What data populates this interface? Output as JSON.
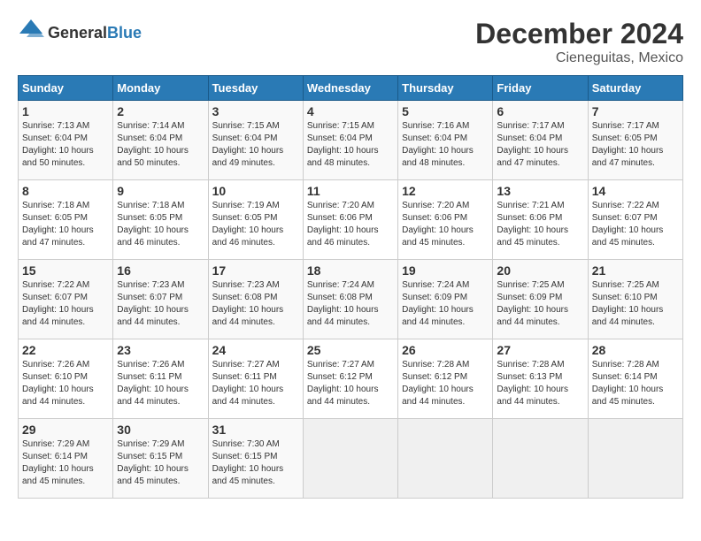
{
  "header": {
    "logo_general": "General",
    "logo_blue": "Blue",
    "month_title": "December 2024",
    "subtitle": "Cieneguitas, Mexico"
  },
  "weekdays": [
    "Sunday",
    "Monday",
    "Tuesday",
    "Wednesday",
    "Thursday",
    "Friday",
    "Saturday"
  ],
  "weeks": [
    [
      {
        "day": "1",
        "info": "Sunrise: 7:13 AM\nSunset: 6:04 PM\nDaylight: 10 hours\nand 50 minutes."
      },
      {
        "day": "2",
        "info": "Sunrise: 7:14 AM\nSunset: 6:04 PM\nDaylight: 10 hours\nand 50 minutes."
      },
      {
        "day": "3",
        "info": "Sunrise: 7:15 AM\nSunset: 6:04 PM\nDaylight: 10 hours\nand 49 minutes."
      },
      {
        "day": "4",
        "info": "Sunrise: 7:15 AM\nSunset: 6:04 PM\nDaylight: 10 hours\nand 48 minutes."
      },
      {
        "day": "5",
        "info": "Sunrise: 7:16 AM\nSunset: 6:04 PM\nDaylight: 10 hours\nand 48 minutes."
      },
      {
        "day": "6",
        "info": "Sunrise: 7:17 AM\nSunset: 6:04 PM\nDaylight: 10 hours\nand 47 minutes."
      },
      {
        "day": "7",
        "info": "Sunrise: 7:17 AM\nSunset: 6:05 PM\nDaylight: 10 hours\nand 47 minutes."
      }
    ],
    [
      {
        "day": "8",
        "info": "Sunrise: 7:18 AM\nSunset: 6:05 PM\nDaylight: 10 hours\nand 47 minutes."
      },
      {
        "day": "9",
        "info": "Sunrise: 7:18 AM\nSunset: 6:05 PM\nDaylight: 10 hours\nand 46 minutes."
      },
      {
        "day": "10",
        "info": "Sunrise: 7:19 AM\nSunset: 6:05 PM\nDaylight: 10 hours\nand 46 minutes."
      },
      {
        "day": "11",
        "info": "Sunrise: 7:20 AM\nSunset: 6:06 PM\nDaylight: 10 hours\nand 46 minutes."
      },
      {
        "day": "12",
        "info": "Sunrise: 7:20 AM\nSunset: 6:06 PM\nDaylight: 10 hours\nand 45 minutes."
      },
      {
        "day": "13",
        "info": "Sunrise: 7:21 AM\nSunset: 6:06 PM\nDaylight: 10 hours\nand 45 minutes."
      },
      {
        "day": "14",
        "info": "Sunrise: 7:22 AM\nSunset: 6:07 PM\nDaylight: 10 hours\nand 45 minutes."
      }
    ],
    [
      {
        "day": "15",
        "info": "Sunrise: 7:22 AM\nSunset: 6:07 PM\nDaylight: 10 hours\nand 44 minutes."
      },
      {
        "day": "16",
        "info": "Sunrise: 7:23 AM\nSunset: 6:07 PM\nDaylight: 10 hours\nand 44 minutes."
      },
      {
        "day": "17",
        "info": "Sunrise: 7:23 AM\nSunset: 6:08 PM\nDaylight: 10 hours\nand 44 minutes."
      },
      {
        "day": "18",
        "info": "Sunrise: 7:24 AM\nSunset: 6:08 PM\nDaylight: 10 hours\nand 44 minutes."
      },
      {
        "day": "19",
        "info": "Sunrise: 7:24 AM\nSunset: 6:09 PM\nDaylight: 10 hours\nand 44 minutes."
      },
      {
        "day": "20",
        "info": "Sunrise: 7:25 AM\nSunset: 6:09 PM\nDaylight: 10 hours\nand 44 minutes."
      },
      {
        "day": "21",
        "info": "Sunrise: 7:25 AM\nSunset: 6:10 PM\nDaylight: 10 hours\nand 44 minutes."
      }
    ],
    [
      {
        "day": "22",
        "info": "Sunrise: 7:26 AM\nSunset: 6:10 PM\nDaylight: 10 hours\nand 44 minutes."
      },
      {
        "day": "23",
        "info": "Sunrise: 7:26 AM\nSunset: 6:11 PM\nDaylight: 10 hours\nand 44 minutes."
      },
      {
        "day": "24",
        "info": "Sunrise: 7:27 AM\nSunset: 6:11 PM\nDaylight: 10 hours\nand 44 minutes."
      },
      {
        "day": "25",
        "info": "Sunrise: 7:27 AM\nSunset: 6:12 PM\nDaylight: 10 hours\nand 44 minutes."
      },
      {
        "day": "26",
        "info": "Sunrise: 7:28 AM\nSunset: 6:12 PM\nDaylight: 10 hours\nand 44 minutes."
      },
      {
        "day": "27",
        "info": "Sunrise: 7:28 AM\nSunset: 6:13 PM\nDaylight: 10 hours\nand 44 minutes."
      },
      {
        "day": "28",
        "info": "Sunrise: 7:28 AM\nSunset: 6:14 PM\nDaylight: 10 hours\nand 45 minutes."
      }
    ],
    [
      {
        "day": "29",
        "info": "Sunrise: 7:29 AM\nSunset: 6:14 PM\nDaylight: 10 hours\nand 45 minutes."
      },
      {
        "day": "30",
        "info": "Sunrise: 7:29 AM\nSunset: 6:15 PM\nDaylight: 10 hours\nand 45 minutes."
      },
      {
        "day": "31",
        "info": "Sunrise: 7:30 AM\nSunset: 6:15 PM\nDaylight: 10 hours\nand 45 minutes."
      },
      {
        "day": "",
        "info": ""
      },
      {
        "day": "",
        "info": ""
      },
      {
        "day": "",
        "info": ""
      },
      {
        "day": "",
        "info": ""
      }
    ]
  ]
}
